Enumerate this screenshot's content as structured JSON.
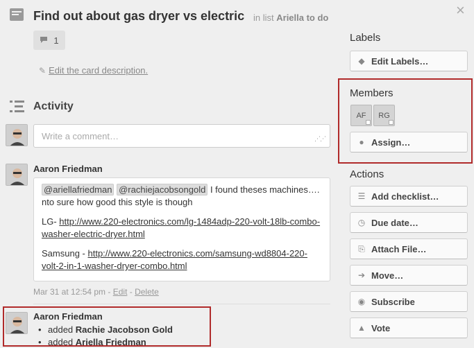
{
  "card": {
    "title": "Find out about gas dryer vs electric",
    "in_list_prefix": "in list",
    "list_name": "Ariella to do",
    "close_icon": "×",
    "comment_count": "1",
    "edit_description": "Edit the card description."
  },
  "activity": {
    "heading": "Activity",
    "comment_placeholder": "Write a comment…",
    "comment": {
      "author": "Aaron Friedman",
      "mention1": "@ariellafriedman",
      "mention2": "@rachiejacobsongold",
      "text1": " I found theses machines…. nto sure how good this style is though",
      "lg_label": "LG- ",
      "lg_link": "http://www.220-electronics.com/lg-1484adp-220-volt-18lb-combo-washer-electric-dryer.html",
      "samsung_label": "Samsung - ",
      "samsung_link": "http://www.220-electronics.com/samsung-wd8804-220-volt-2-in-1-washer-dryer-combo.html",
      "date": "Mar 31 at 12:54 pm",
      "sep": " - ",
      "edit": "Edit",
      "delete": "Delete"
    },
    "action": {
      "author": "Aaron Friedman",
      "items": [
        {
          "prefix": "added ",
          "name": "Rachie Jacobson Gold"
        },
        {
          "prefix": "added ",
          "name": "Ariella Friedman"
        }
      ]
    }
  },
  "sidebar": {
    "labels_heading": "Labels",
    "edit_labels": "Edit Labels…",
    "members_heading": "Members",
    "members": [
      "AF",
      "RG"
    ],
    "assign": "Assign…",
    "actions_heading": "Actions",
    "actions": [
      "Add checklist…",
      "Due date…",
      "Attach File…",
      "Move…",
      "Subscribe",
      "Vote"
    ]
  },
  "colors": {
    "highlight": "#b02a2a",
    "background": "#efefef"
  },
  "icons": [
    "card-icon",
    "comment-icon",
    "pencil-icon",
    "activity-icon",
    "tag-icon",
    "person-icon",
    "checklist-icon",
    "clock-icon",
    "paperclip-icon",
    "arrow-right-icon",
    "eye-icon",
    "thumbs-up-icon"
  ]
}
